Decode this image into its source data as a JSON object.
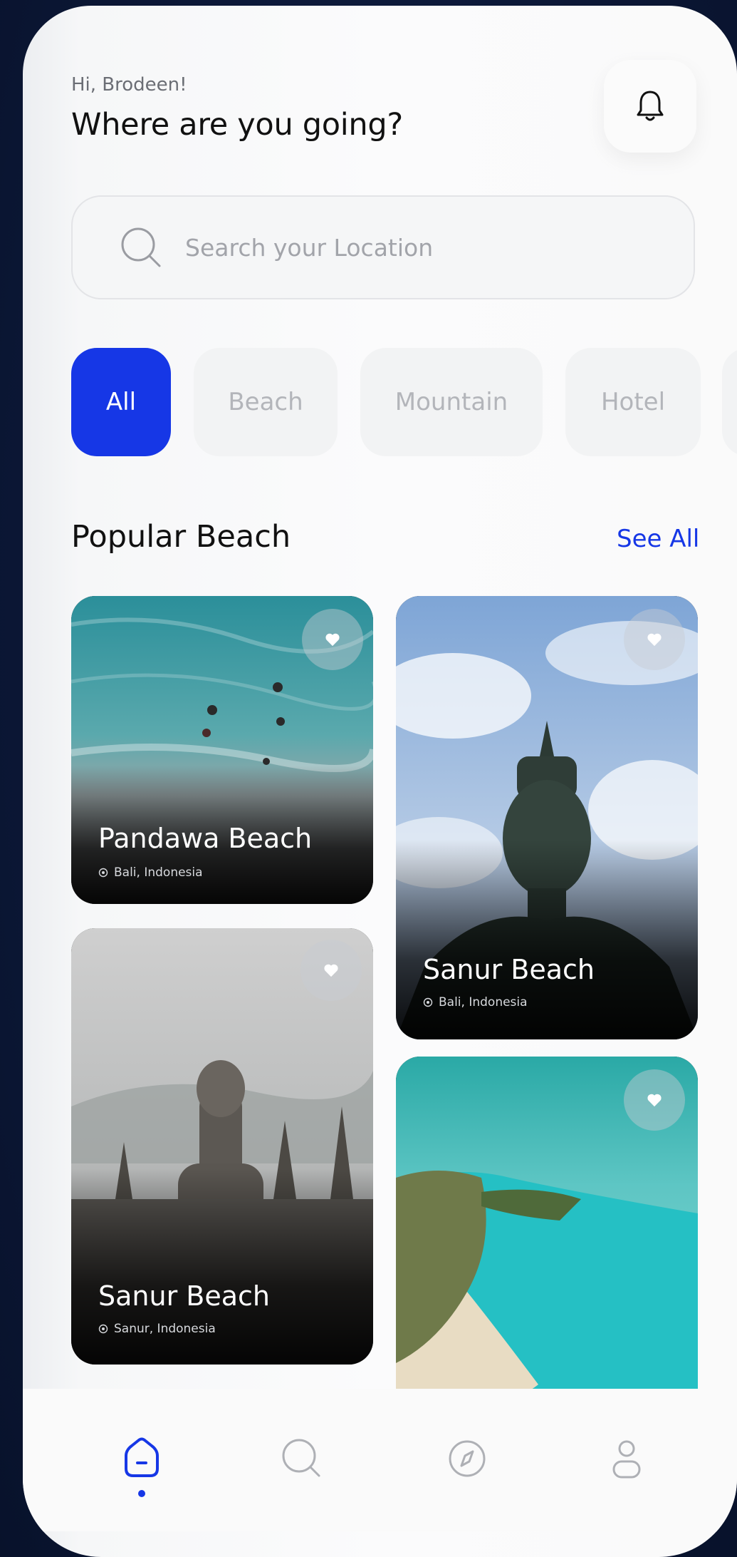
{
  "header": {
    "greeting": "Hi, Brodeen!",
    "title": "Where are you going?"
  },
  "search": {
    "placeholder": "Search your Location"
  },
  "categories": [
    {
      "label": "All",
      "active": true
    },
    {
      "label": "Beach",
      "active": false
    },
    {
      "label": "Mountain",
      "active": false
    },
    {
      "label": "Hotel",
      "active": false
    }
  ],
  "section": {
    "title": "Popular Beach",
    "see_all": "See All"
  },
  "cards": [
    {
      "name": "Pandawa Beach",
      "location": "Bali, Indonesia"
    },
    {
      "name": "Sanur Beach",
      "location": "Bali, Indonesia"
    },
    {
      "name": "Sanur Beach",
      "location": "Sanur, Indonesia"
    },
    {
      "name": "",
      "location": ""
    }
  ],
  "nav": [
    {
      "icon": "home-icon",
      "active": true
    },
    {
      "icon": "search-icon",
      "active": false
    },
    {
      "icon": "compass-icon",
      "active": false
    },
    {
      "icon": "profile-icon",
      "active": false
    }
  ],
  "colors": {
    "accent": "#1637e6",
    "background": "#0c1838",
    "card_text": "#ffffff"
  }
}
